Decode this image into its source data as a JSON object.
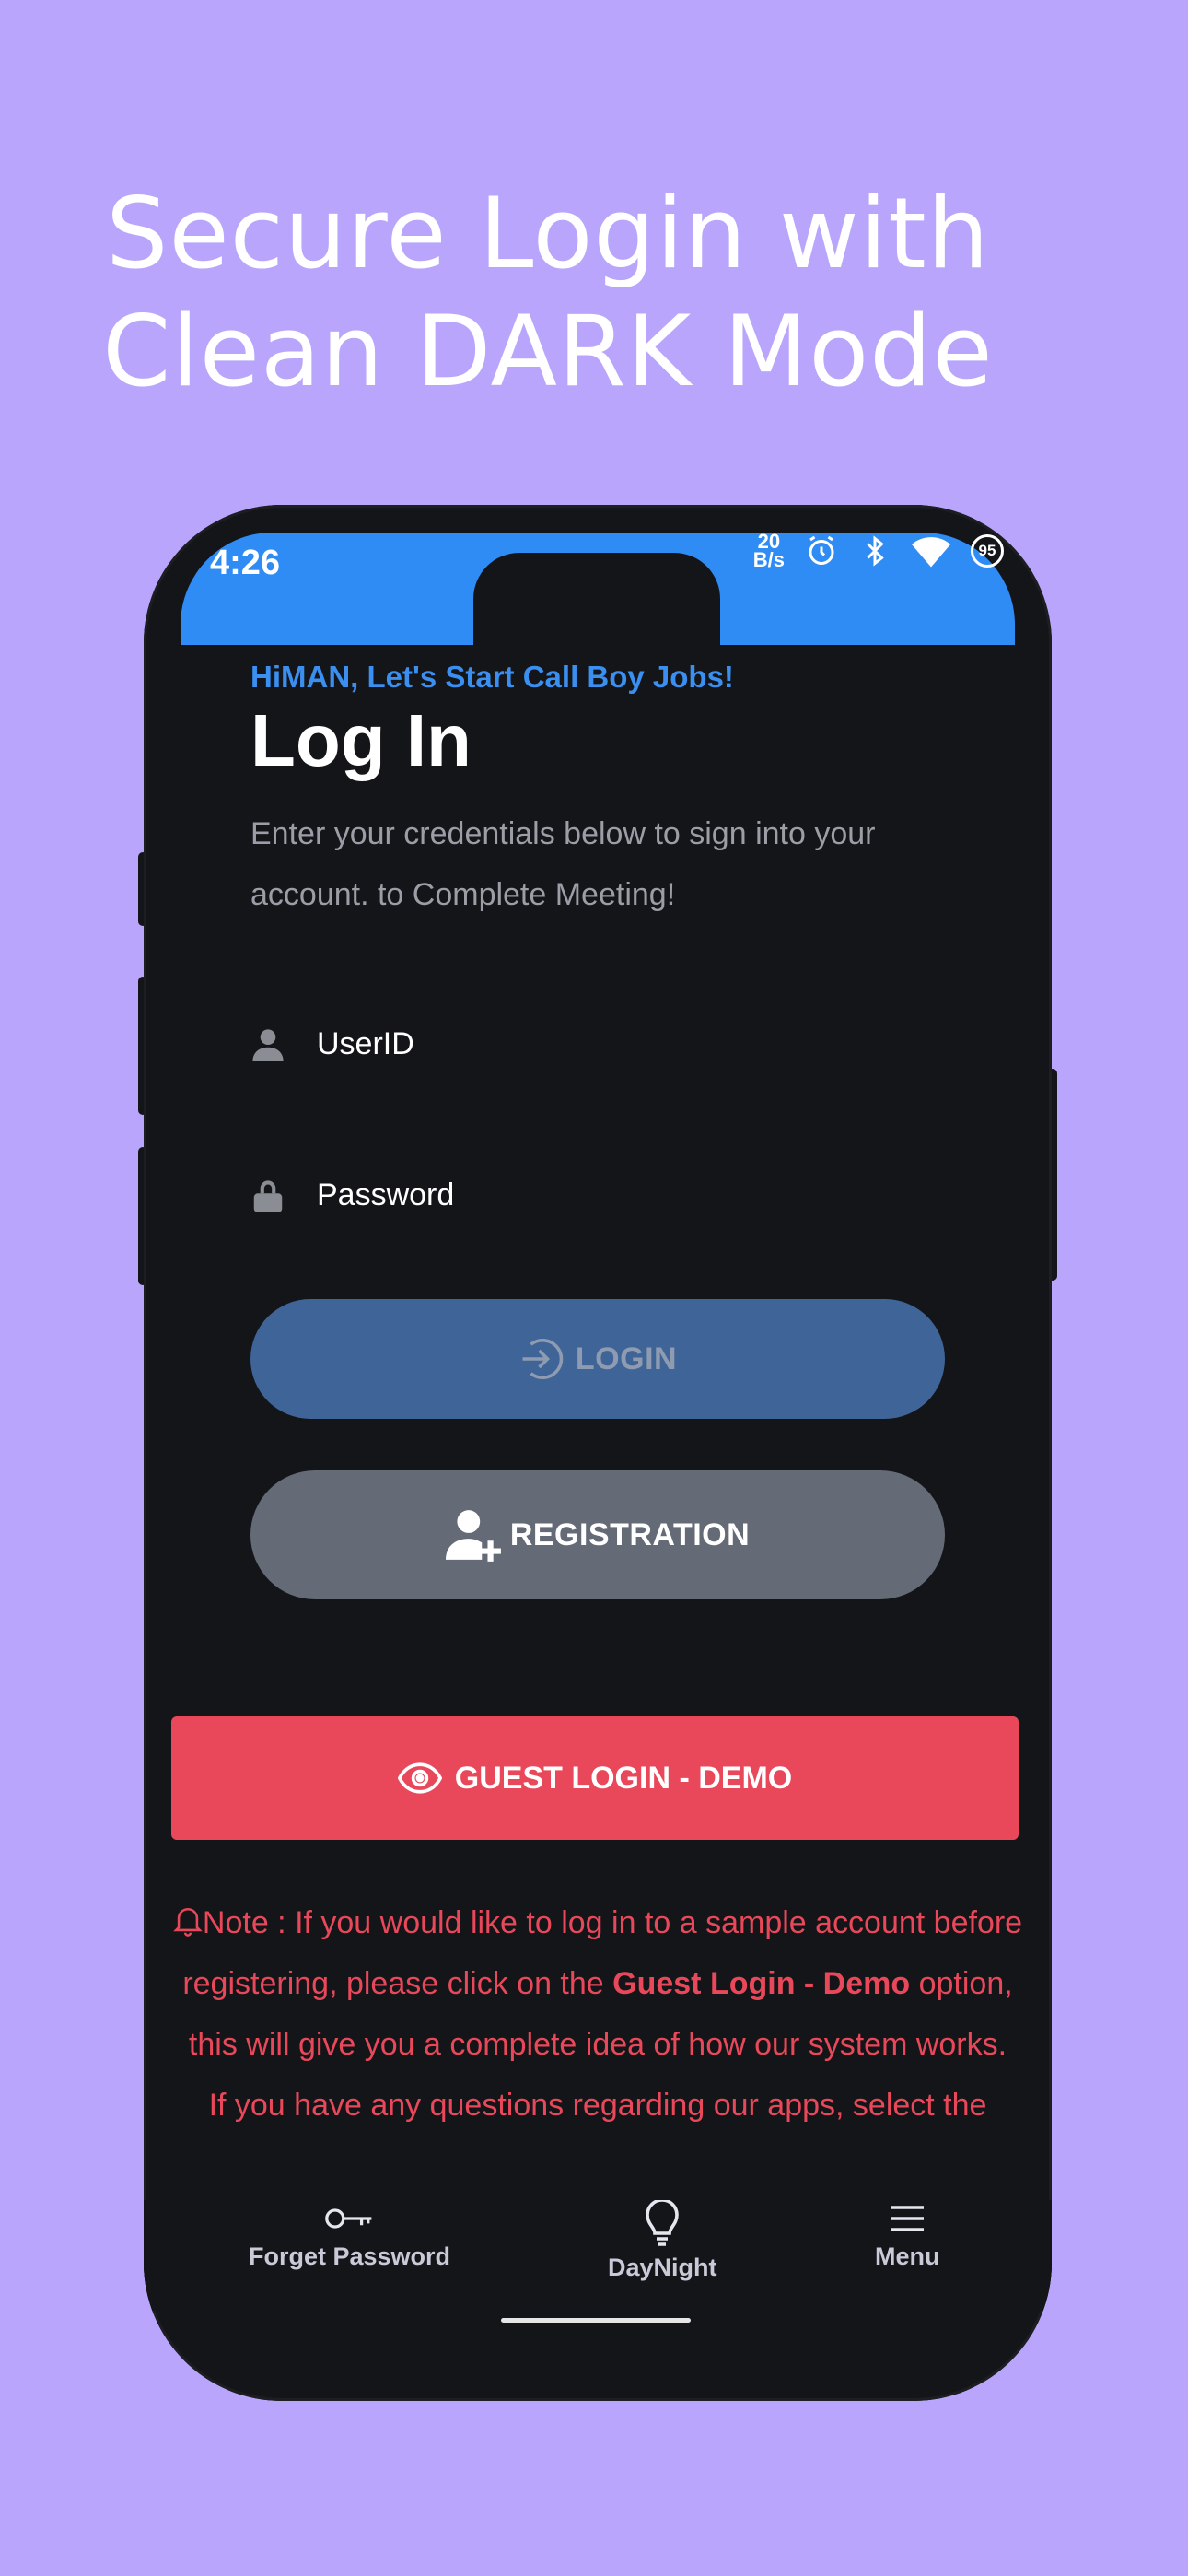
{
  "headline": {
    "line1": "Secure Login with",
    "line2": "Clean DARK Mode"
  },
  "status_bar": {
    "time": "4:26",
    "net_speed_top": "20",
    "net_speed_bottom": "B/s",
    "battery": "95"
  },
  "login": {
    "greeting": "HiMAN, Let's Start Call Boy Jobs!",
    "title": "Log In",
    "description": "Enter your credentials below to sign into your account. to Complete Meeting!"
  },
  "fields": {
    "userid_placeholder": "UserID",
    "password_placeholder": "Password"
  },
  "buttons": {
    "login": "LOGIN",
    "registration": "REGISTRATION",
    "guest": "GUEST LOGIN - DEMO"
  },
  "note": {
    "prefix": "Note : If you would like to log in to a sample account before registering, please click on the ",
    "bold": "Guest Login - Demo",
    "suffix": " option, this will give you a complete idea of how our system works.",
    "line2": "If you have any questions regarding our apps, select the"
  },
  "bottom_nav": {
    "forget": "Forget Password",
    "daynight": "DayNight",
    "menu": "Menu"
  },
  "colors": {
    "background": "#b9a6fc",
    "status_bar": "#2f8cf5",
    "accent_blue": "#3a8ff0",
    "login_button": "#3e6498",
    "registration_button": "#646b76",
    "guest_button": "#e8485a",
    "screen": "#141518"
  },
  "icons": {
    "user": "user-icon",
    "lock": "lock-icon",
    "login": "sign-in-icon",
    "registration": "user-plus-icon",
    "guest": "eye-icon",
    "note": "bell-icon",
    "forget": "key-icon",
    "daynight": "lightbulb-icon",
    "menu": "hamburger-icon"
  }
}
